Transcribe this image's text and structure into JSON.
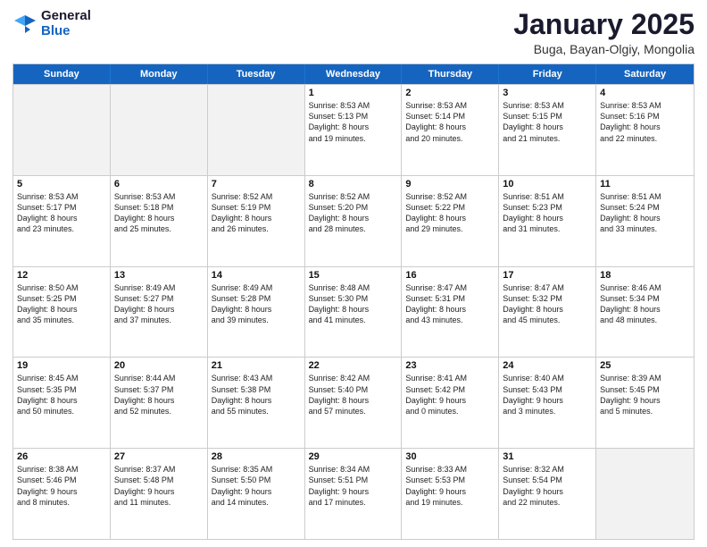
{
  "logo": {
    "general": "General",
    "blue": "Blue"
  },
  "title": "January 2025",
  "subtitle": "Buga, Bayan-Olgiy, Mongolia",
  "days": [
    "Sunday",
    "Monday",
    "Tuesday",
    "Wednesday",
    "Thursday",
    "Friday",
    "Saturday"
  ],
  "weeks": [
    [
      {
        "day": "",
        "text": "",
        "shaded": true
      },
      {
        "day": "",
        "text": "",
        "shaded": true
      },
      {
        "day": "",
        "text": "",
        "shaded": true
      },
      {
        "day": "1",
        "text": "Sunrise: 8:53 AM\nSunset: 5:13 PM\nDaylight: 8 hours\nand 19 minutes.",
        "shaded": false
      },
      {
        "day": "2",
        "text": "Sunrise: 8:53 AM\nSunset: 5:14 PM\nDaylight: 8 hours\nand 20 minutes.",
        "shaded": false
      },
      {
        "day": "3",
        "text": "Sunrise: 8:53 AM\nSunset: 5:15 PM\nDaylight: 8 hours\nand 21 minutes.",
        "shaded": false
      },
      {
        "day": "4",
        "text": "Sunrise: 8:53 AM\nSunset: 5:16 PM\nDaylight: 8 hours\nand 22 minutes.",
        "shaded": false
      }
    ],
    [
      {
        "day": "5",
        "text": "Sunrise: 8:53 AM\nSunset: 5:17 PM\nDaylight: 8 hours\nand 23 minutes.",
        "shaded": false
      },
      {
        "day": "6",
        "text": "Sunrise: 8:53 AM\nSunset: 5:18 PM\nDaylight: 8 hours\nand 25 minutes.",
        "shaded": false
      },
      {
        "day": "7",
        "text": "Sunrise: 8:52 AM\nSunset: 5:19 PM\nDaylight: 8 hours\nand 26 minutes.",
        "shaded": false
      },
      {
        "day": "8",
        "text": "Sunrise: 8:52 AM\nSunset: 5:20 PM\nDaylight: 8 hours\nand 28 minutes.",
        "shaded": false
      },
      {
        "day": "9",
        "text": "Sunrise: 8:52 AM\nSunset: 5:22 PM\nDaylight: 8 hours\nand 29 minutes.",
        "shaded": false
      },
      {
        "day": "10",
        "text": "Sunrise: 8:51 AM\nSunset: 5:23 PM\nDaylight: 8 hours\nand 31 minutes.",
        "shaded": false
      },
      {
        "day": "11",
        "text": "Sunrise: 8:51 AM\nSunset: 5:24 PM\nDaylight: 8 hours\nand 33 minutes.",
        "shaded": false
      }
    ],
    [
      {
        "day": "12",
        "text": "Sunrise: 8:50 AM\nSunset: 5:25 PM\nDaylight: 8 hours\nand 35 minutes.",
        "shaded": false
      },
      {
        "day": "13",
        "text": "Sunrise: 8:49 AM\nSunset: 5:27 PM\nDaylight: 8 hours\nand 37 minutes.",
        "shaded": false
      },
      {
        "day": "14",
        "text": "Sunrise: 8:49 AM\nSunset: 5:28 PM\nDaylight: 8 hours\nand 39 minutes.",
        "shaded": false
      },
      {
        "day": "15",
        "text": "Sunrise: 8:48 AM\nSunset: 5:30 PM\nDaylight: 8 hours\nand 41 minutes.",
        "shaded": false
      },
      {
        "day": "16",
        "text": "Sunrise: 8:47 AM\nSunset: 5:31 PM\nDaylight: 8 hours\nand 43 minutes.",
        "shaded": false
      },
      {
        "day": "17",
        "text": "Sunrise: 8:47 AM\nSunset: 5:32 PM\nDaylight: 8 hours\nand 45 minutes.",
        "shaded": false
      },
      {
        "day": "18",
        "text": "Sunrise: 8:46 AM\nSunset: 5:34 PM\nDaylight: 8 hours\nand 48 minutes.",
        "shaded": false
      }
    ],
    [
      {
        "day": "19",
        "text": "Sunrise: 8:45 AM\nSunset: 5:35 PM\nDaylight: 8 hours\nand 50 minutes.",
        "shaded": false
      },
      {
        "day": "20",
        "text": "Sunrise: 8:44 AM\nSunset: 5:37 PM\nDaylight: 8 hours\nand 52 minutes.",
        "shaded": false
      },
      {
        "day": "21",
        "text": "Sunrise: 8:43 AM\nSunset: 5:38 PM\nDaylight: 8 hours\nand 55 minutes.",
        "shaded": false
      },
      {
        "day": "22",
        "text": "Sunrise: 8:42 AM\nSunset: 5:40 PM\nDaylight: 8 hours\nand 57 minutes.",
        "shaded": false
      },
      {
        "day": "23",
        "text": "Sunrise: 8:41 AM\nSunset: 5:42 PM\nDaylight: 9 hours\nand 0 minutes.",
        "shaded": false
      },
      {
        "day": "24",
        "text": "Sunrise: 8:40 AM\nSunset: 5:43 PM\nDaylight: 9 hours\nand 3 minutes.",
        "shaded": false
      },
      {
        "day": "25",
        "text": "Sunrise: 8:39 AM\nSunset: 5:45 PM\nDaylight: 9 hours\nand 5 minutes.",
        "shaded": false
      }
    ],
    [
      {
        "day": "26",
        "text": "Sunrise: 8:38 AM\nSunset: 5:46 PM\nDaylight: 9 hours\nand 8 minutes.",
        "shaded": false
      },
      {
        "day": "27",
        "text": "Sunrise: 8:37 AM\nSunset: 5:48 PM\nDaylight: 9 hours\nand 11 minutes.",
        "shaded": false
      },
      {
        "day": "28",
        "text": "Sunrise: 8:35 AM\nSunset: 5:50 PM\nDaylight: 9 hours\nand 14 minutes.",
        "shaded": false
      },
      {
        "day": "29",
        "text": "Sunrise: 8:34 AM\nSunset: 5:51 PM\nDaylight: 9 hours\nand 17 minutes.",
        "shaded": false
      },
      {
        "day": "30",
        "text": "Sunrise: 8:33 AM\nSunset: 5:53 PM\nDaylight: 9 hours\nand 19 minutes.",
        "shaded": false
      },
      {
        "day": "31",
        "text": "Sunrise: 8:32 AM\nSunset: 5:54 PM\nDaylight: 9 hours\nand 22 minutes.",
        "shaded": false
      },
      {
        "day": "",
        "text": "",
        "shaded": true
      }
    ]
  ]
}
